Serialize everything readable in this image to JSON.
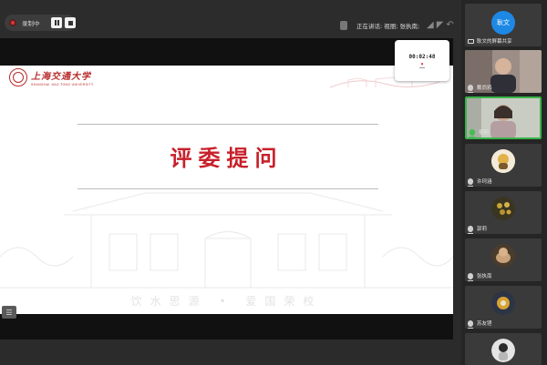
{
  "recording": {
    "label": "录制中"
  },
  "speaking": {
    "text": "正在讲话: 祖丽; 张执南;"
  },
  "timer": {
    "elapsed": "00:02:48"
  },
  "slide": {
    "logo_cn": "上海交通大学",
    "logo_en": "SHANGHAI JIAO TONG UNIVERSITY",
    "title": "评委提问",
    "motto_left": "饮水思源",
    "motto_sep": "•",
    "motto_right": "爱国荣校"
  },
  "participants": [
    {
      "name": "耿文的屏幕共享",
      "avatar_text": "耿文",
      "type": "share"
    },
    {
      "name": "戴尚鸦",
      "type": "video"
    },
    {
      "name": "祖丽",
      "type": "video",
      "speaking": true
    },
    {
      "name": "许珂涵",
      "type": "avatar"
    },
    {
      "name": "郭莉",
      "type": "avatar"
    },
    {
      "name": "张执南",
      "type": "avatar"
    },
    {
      "name": "苏友铿",
      "type": "avatar"
    },
    {
      "name": "",
      "type": "avatar"
    }
  ],
  "colors": {
    "accent_red": "#c8202a",
    "speaking_green": "#39b54a",
    "avatar_blue": "#1e88e5"
  }
}
